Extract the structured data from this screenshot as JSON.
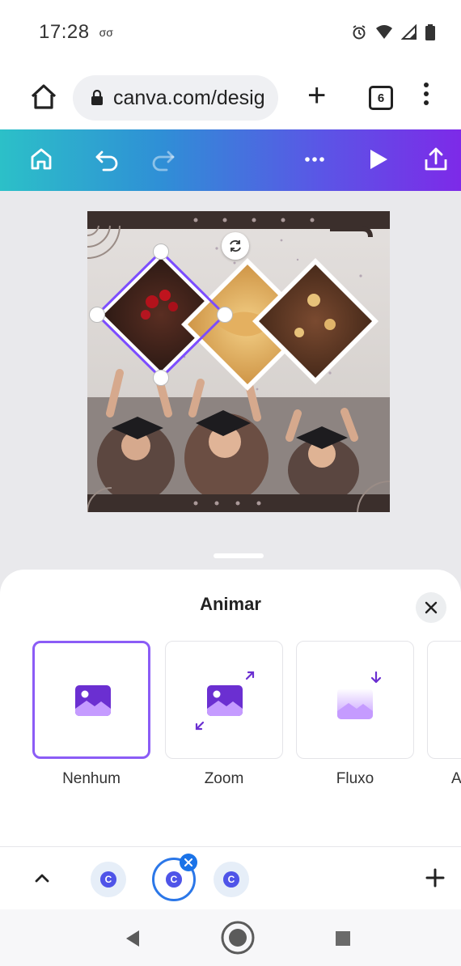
{
  "status": {
    "time": "17:28",
    "voicemail": "σσ"
  },
  "browser": {
    "url": "canva.com/desig",
    "tab_count": "6"
  },
  "sheet": {
    "title": "Animar",
    "options": [
      {
        "label": "Nenhum",
        "selected": true
      },
      {
        "label": "Zoom",
        "selected": false
      },
      {
        "label": "Fluxo",
        "selected": false
      },
      {
        "label": "A",
        "selected": false
      }
    ]
  },
  "colors": {
    "accent": "#8b5cf6",
    "toolbar_gradient_start": "#2cc0c8",
    "toolbar_gradient_end": "#7d2ae8",
    "design_dark": "#3b2f2c"
  },
  "icons": {
    "home": "home-icon",
    "lock": "lock-icon",
    "undo": "undo-icon",
    "redo": "redo-icon",
    "more": "more-icon",
    "play": "play-icon",
    "share": "share-icon",
    "close": "close-icon",
    "rotate": "rotate-icon",
    "chevron": "chevron-up-icon",
    "add": "plus-icon"
  }
}
